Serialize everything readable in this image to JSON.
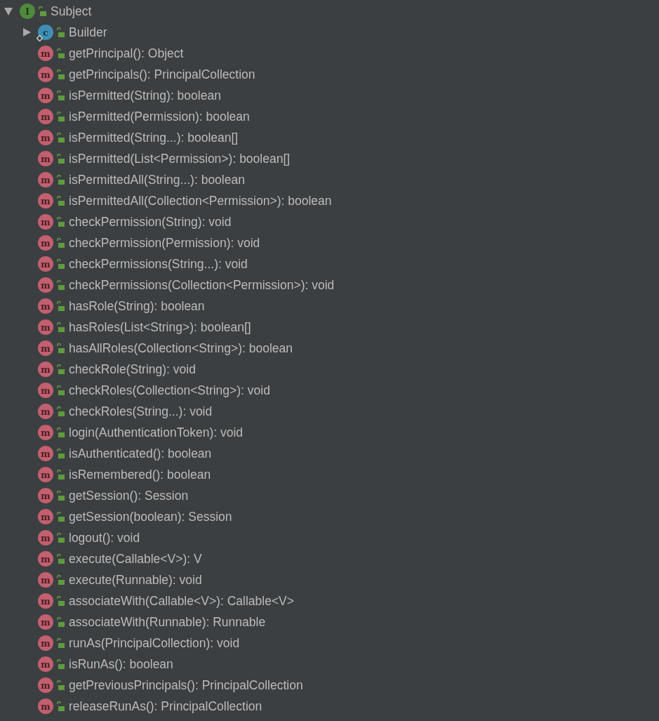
{
  "tree": {
    "label": "Subject",
    "kind": "interface",
    "icon": "I",
    "expanded": true,
    "children": [
      {
        "label": "Builder",
        "kind": "class",
        "icon": "c",
        "expanded": false
      },
      {
        "label": "getPrincipal(): Object",
        "kind": "method",
        "icon": "m"
      },
      {
        "label": "getPrincipals(): PrincipalCollection",
        "kind": "method",
        "icon": "m"
      },
      {
        "label": "isPermitted(String): boolean",
        "kind": "method",
        "icon": "m"
      },
      {
        "label": "isPermitted(Permission): boolean",
        "kind": "method",
        "icon": "m"
      },
      {
        "label": "isPermitted(String...): boolean[]",
        "kind": "method",
        "icon": "m"
      },
      {
        "label": "isPermitted(List<Permission>): boolean[]",
        "kind": "method",
        "icon": "m"
      },
      {
        "label": "isPermittedAll(String...): boolean",
        "kind": "method",
        "icon": "m"
      },
      {
        "label": "isPermittedAll(Collection<Permission>): boolean",
        "kind": "method",
        "icon": "m"
      },
      {
        "label": "checkPermission(String): void",
        "kind": "method",
        "icon": "m"
      },
      {
        "label": "checkPermission(Permission): void",
        "kind": "method",
        "icon": "m"
      },
      {
        "label": "checkPermissions(String...): void",
        "kind": "method",
        "icon": "m"
      },
      {
        "label": "checkPermissions(Collection<Permission>): void",
        "kind": "method",
        "icon": "m"
      },
      {
        "label": "hasRole(String): boolean",
        "kind": "method",
        "icon": "m"
      },
      {
        "label": "hasRoles(List<String>): boolean[]",
        "kind": "method",
        "icon": "m"
      },
      {
        "label": "hasAllRoles(Collection<String>): boolean",
        "kind": "method",
        "icon": "m"
      },
      {
        "label": "checkRole(String): void",
        "kind": "method",
        "icon": "m"
      },
      {
        "label": "checkRoles(Collection<String>): void",
        "kind": "method",
        "icon": "m"
      },
      {
        "label": "checkRoles(String...): void",
        "kind": "method",
        "icon": "m"
      },
      {
        "label": "login(AuthenticationToken): void",
        "kind": "method",
        "icon": "m"
      },
      {
        "label": "isAuthenticated(): boolean",
        "kind": "method",
        "icon": "m"
      },
      {
        "label": "isRemembered(): boolean",
        "kind": "method",
        "icon": "m"
      },
      {
        "label": "getSession(): Session",
        "kind": "method",
        "icon": "m"
      },
      {
        "label": "getSession(boolean): Session",
        "kind": "method",
        "icon": "m"
      },
      {
        "label": "logout(): void",
        "kind": "method",
        "icon": "m"
      },
      {
        "label": "execute(Callable<V>): V",
        "kind": "method",
        "icon": "m"
      },
      {
        "label": "execute(Runnable): void",
        "kind": "method",
        "icon": "m"
      },
      {
        "label": "associateWith(Callable<V>): Callable<V>",
        "kind": "method",
        "icon": "m"
      },
      {
        "label": "associateWith(Runnable): Runnable",
        "kind": "method",
        "icon": "m"
      },
      {
        "label": "runAs(PrincipalCollection): void",
        "kind": "method",
        "icon": "m"
      },
      {
        "label": "isRunAs(): boolean",
        "kind": "method",
        "icon": "m"
      },
      {
        "label": "getPreviousPrincipals(): PrincipalCollection",
        "kind": "method",
        "icon": "m"
      },
      {
        "label": "releaseRunAs(): PrincipalCollection",
        "kind": "method",
        "icon": "m"
      }
    ]
  }
}
